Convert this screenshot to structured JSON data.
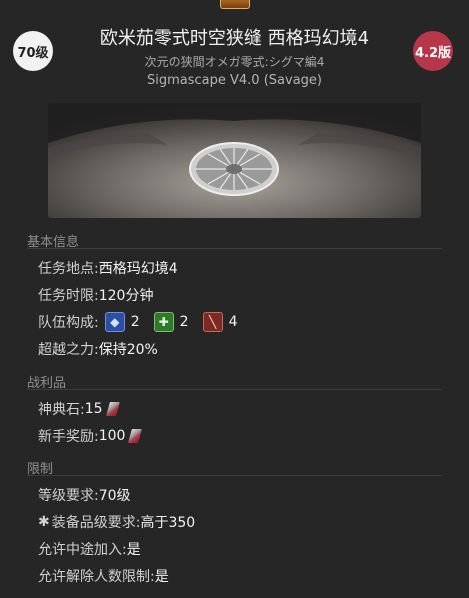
{
  "header": {
    "level_badge": "70级",
    "version_badge": "4.2版",
    "title": "欧米茄零式时空狭缝 西格玛幻境4",
    "subtitle_jp": "次元の狭間オメガ零式:シグマ編4",
    "subtitle_en": "Sigmascape V4.0 (Savage)"
  },
  "sections": {
    "basic": {
      "title": "基本信息",
      "location_label": "任务地点:",
      "location_value": "西格玛幻境4",
      "time_label": "任务时限:",
      "time_value": "120分钟",
      "party_label": "队伍构成:",
      "tank_count": "2",
      "healer_count": "2",
      "dps_count": "4",
      "echo_label": "超越之力:",
      "echo_value": "保持20%"
    },
    "loot": {
      "title": "战利品",
      "tomestone_label": "神典石:",
      "tomestone_value": "15",
      "novice_label": "新手奖励:",
      "novice_value": "100"
    },
    "restrictions": {
      "title": "限制",
      "level_label": "等级要求:",
      "level_value": "70级",
      "ilvl_label": "装备品级要求:",
      "ilvl_value": "高于350",
      "join_label": "允许中途加入:",
      "join_value": "是",
      "unsync_label": "允许解除人数限制:",
      "unsync_value": "是"
    }
  },
  "icons": {
    "tank": "shield-icon",
    "healer": "cross-icon",
    "dps": "sword-icon",
    "tomestone": "tomestone-icon",
    "ilvl": "item-level-icon"
  },
  "colors": {
    "background": "#262626",
    "version_badge": "#b8364a",
    "section_header": "#8f8f8f"
  }
}
